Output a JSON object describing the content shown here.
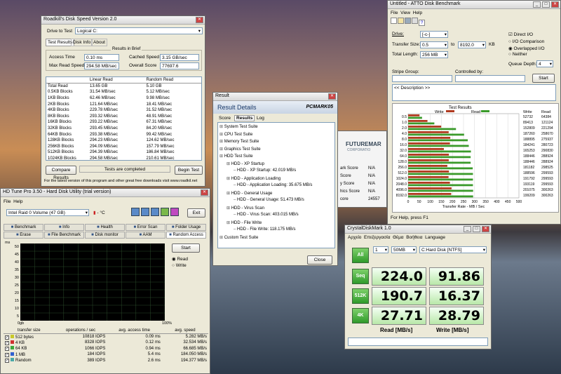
{
  "roadkill": {
    "title": "Roadkill's Disk Speed Version 2.0",
    "drive_label": "Drive to Test",
    "drive_value": "Logical C:",
    "tabs": [
      "Test Results",
      "Disk Info",
      "About"
    ],
    "brief_label": "Results in Brief",
    "brief": [
      {
        "k": "Access Time",
        "v": "0.10 ms",
        "k2": "Cached Speed",
        "v2": "3.15 GB/sec"
      },
      {
        "k": "Max Read Speed",
        "v": "294.58 MB/sec",
        "k2": "Overall Score",
        "v2": "77697.6"
      }
    ],
    "cols": [
      "",
      "Linear Read",
      "Random Read"
    ],
    "rows": [
      [
        "Total Read",
        "13.65 GB",
        "5.10 GB"
      ],
      [
        "0.5KB Blocks",
        "31.54 MB/sec",
        "5.12 MB/sec"
      ],
      [
        "1KB Blocks",
        "62.46 MB/sec",
        "9.98 MB/sec"
      ],
      [
        "2KB Blocks",
        "121.64 MB/sec",
        "18.41 MB/sec"
      ],
      [
        "4KB Blocks",
        "229.78 MB/sec",
        "31.52 MB/sec"
      ],
      [
        "8KB Blocks",
        "293.32 MB/sec",
        "48.91 MB/sec"
      ],
      [
        "16KB Blocks",
        "293.22 MB/sec",
        "67.31 MB/sec"
      ],
      [
        "32KB Blocks",
        "293.45 MB/sec",
        "84.20 MB/sec"
      ],
      [
        "64KB Blocks",
        "293.38 MB/sec",
        "99.42 MB/sec"
      ],
      [
        "128KB Blocks",
        "294.23 MB/sec",
        "124.62 MB/sec"
      ],
      [
        "256KB Blocks",
        "294.09 MB/sec",
        "157.79 MB/sec"
      ],
      [
        "512KB Blocks",
        "294.39 MB/sec",
        "186.84 MB/sec"
      ],
      [
        "1024KB Blocks",
        "294.58 MB/sec",
        "210.61 MB/sec"
      ]
    ],
    "compare_label": "Compare Results",
    "status": "Tests are completed",
    "begin_label": "Begin Test",
    "footer": "For the latest version of this program and other great free downloads visit www.roadkil.net"
  },
  "atto": {
    "title": "Untitled - ATTO Disk Benchmark",
    "menu": [
      "File",
      "View",
      "Help"
    ],
    "drive_label": "Drive:",
    "drive_value": "[-c-]",
    "tsize_label": "Transfer Size:",
    "tsize_from": "0.5",
    "tsize_to_label": "to",
    "tsize_to": "8192.0",
    "kb": "KB",
    "tlen_label": "Total Length:",
    "tlen_value": "256 MB",
    "direct_io": "Direct I/O",
    "io_comparison": "I/O Comparison",
    "overlapped_io": "Overlapped I/O",
    "neither": "Neither",
    "qd_label": "Queue Depth:",
    "qd_value": "4",
    "stripe_label": "Stripe Group:",
    "controlled_label": "Controlled by:",
    "start_label": "Start",
    "desc": "<< Description >>",
    "results_label": "Test Results",
    "write_label": "Write",
    "read_label": "Read",
    "col_write": "Write",
    "col_read": "Read",
    "xlabel": "Transfer Rate - MB / Sec",
    "status": "For Help, press F1"
  },
  "chart_data": {
    "type": "bar",
    "title": "Test Results",
    "xlabel": "Transfer Rate - MB / Sec",
    "xlim": [
      0,
      500
    ],
    "xticks": [
      "0",
      "50",
      "100",
      "150",
      "200",
      "250",
      "300",
      "350",
      "400",
      "450",
      "500"
    ],
    "categories": [
      "0.5",
      "1.0",
      "2.0",
      "4.0",
      "8.0",
      "16.0",
      "32.0",
      "64.0",
      "128.0",
      "256.0",
      "512.0",
      "1024.0",
      "2048.0",
      "4096.0",
      "8192.0"
    ],
    "series": [
      {
        "name": "Write",
        "color": "#b03a1f",
        "values": [
          51.4,
          87.3,
          149.2,
          183.0,
          190.3,
          188.7,
          161.3,
          184.0,
          183.3,
          177.0,
          184.2,
          182.4,
          188.6,
          196.1,
          194.5
        ]
      },
      {
        "name": "Read",
        "color": "#3a9a2a",
        "values": [
          62.9,
          118.3,
          215.9,
          252.6,
          269.0,
          273.7,
          283.4,
          282.1,
          282.1,
          291.5,
          292.5,
          292.5,
          292.5,
          293.3,
          293.3
        ]
      }
    ],
    "write_text": [
      "52732",
      "89413",
      "152809",
      "187260",
      "188895",
      "184241",
      "165253",
      "188446",
      "188446",
      "181182",
      "188596",
      "191792",
      "193119",
      "201075",
      "199209"
    ],
    "read_text": [
      "64384",
      "121124",
      "221294",
      "258670",
      "275937",
      "280723",
      "290830",
      "288924",
      "288924",
      "298525",
      "299593",
      "299593",
      "299593",
      "300263",
      "300263"
    ]
  },
  "result": {
    "title": "Result",
    "header": "Result Details",
    "brand": "PCMARK05",
    "tabs": [
      "Score",
      "Results",
      "Log"
    ],
    "tree": [
      "System Test Suite",
      "CPU Test Suite",
      "Memory Test Suite",
      "Graphics Test Suite",
      "HDD Test Suite",
      "HDD - XP Startup",
      "HDD - XP Startup: 42.019 MB/s",
      "HDD - Application Loading",
      "HDD - Application Loading: 35.675 MB/s",
      "HDD - General Usage",
      "HDD - General Usage: 51.473 MB/s",
      "HDD - Virus Scan",
      "HDD - Virus Scan: 403.015 MB/s",
      "HDD - File Write",
      "HDD - File Write: 118.175 MB/s",
      "Custom Test Suite"
    ],
    "close_label": "Close"
  },
  "futuremark": {
    "brand": "FUTUREMAR",
    "sub": "CORPORATIO",
    "rows": [
      [
        "ark Score",
        "N/A"
      ],
      [
        "Score",
        "N/A"
      ],
      [
        "y Score",
        "N/A"
      ],
      [
        "hics Score",
        "N/A"
      ],
      [
        "core",
        "24557"
      ]
    ]
  },
  "hdtune": {
    "title": "HD Tune Pro 3.50 - Hard Disk Utility (trial version)",
    "menu": [
      "File",
      "Help"
    ],
    "drive": "Intel  Raid 0 Volume (47 GB)",
    "temp": "- °C",
    "exit_label": "Exit",
    "tabs1": [
      "Benchmark",
      "Info",
      "Health",
      "Error Scan",
      "Folder Usage"
    ],
    "tabs2": [
      "Erase",
      "File Benchmark",
      "Disk monitor",
      "AAM",
      "Random Access"
    ],
    "yticks": [
      "50",
      "45",
      "40",
      "35",
      "30",
      "25",
      "20",
      "15",
      "10",
      "5"
    ],
    "yunit": "ms",
    "xticks": [
      "0gb",
      "",
      "",
      "",
      "",
      "",
      "",
      "",
      "",
      "",
      "",
      "100%"
    ],
    "start_label": "Start",
    "read_label": "Read",
    "write_label": "Write",
    "cols": [
      "transfer size",
      "operations / sec",
      "avg. access time",
      "avg. speed"
    ],
    "rows": [
      [
        "512 bytes",
        "10818 IOPS",
        "0.09 ms",
        "5.282 MB/s"
      ],
      [
        "4 KB",
        "8328 IOPS",
        "0.12 ms",
        "32.534 MB/s"
      ],
      [
        "64 KB",
        "1066 IOPS",
        "0.94 ms",
        "66.685 MB/s"
      ],
      [
        "1 MB",
        "184 IOPS",
        "5.4 ms",
        "184.050 MB/s"
      ],
      [
        "Random",
        "389 IOPS",
        "2.6 ms",
        "194.377 MB/s"
      ]
    ],
    "row_colors": [
      "#c8c828",
      "#d03030",
      "#3aa83a",
      "#3060d0",
      "#4aa8a8"
    ]
  },
  "cdm": {
    "title": "CrystalDiskMark 1.0",
    "menu": [
      "Αρχείο",
      "Επεξεργασία",
      "Θέμα",
      "Βοήθεια",
      "Language"
    ],
    "count": "1",
    "size": "50MB",
    "drive": "C:Hard Disk [NTFS]",
    "all_label": "All",
    "rows": [
      {
        "label": "Seq",
        "read": "224.0",
        "write": "91.86"
      },
      {
        "label": "512K",
        "read": "190.7",
        "write": "16.37"
      },
      {
        "label": "4K",
        "read": "27.71",
        "write": "28.79"
      }
    ],
    "read_hdr": "Read [MB/s]",
    "write_hdr": "Write [MB/s]"
  }
}
